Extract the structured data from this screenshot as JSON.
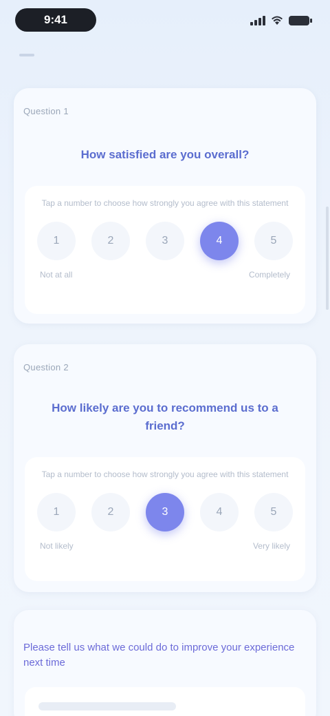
{
  "status_bar": {
    "time": "9:41"
  },
  "question_1": {
    "label": "Question 1",
    "text": "How satisfied are you overall?",
    "hint": "Tap a number to choose how strongly you agree with this statement",
    "options": [
      "1",
      "2",
      "3",
      "4",
      "5"
    ],
    "selected_index": 3,
    "low_label": "Not at all",
    "high_label": "Completely"
  },
  "question_2": {
    "label": "Question 2",
    "text": "How likely are you to recommend us to a friend?",
    "hint": "Tap a number to choose how strongly you agree with this statement",
    "options": [
      "1",
      "2",
      "3",
      "4",
      "5"
    ],
    "selected_index": 2,
    "low_label": "Not likely",
    "high_label": "Very likely"
  },
  "question_3": {
    "text": "Please tell us what we could do to improve your experience next time"
  },
  "colors": {
    "accent": "#7d86ec",
    "question_text": "#5b6dcf"
  }
}
